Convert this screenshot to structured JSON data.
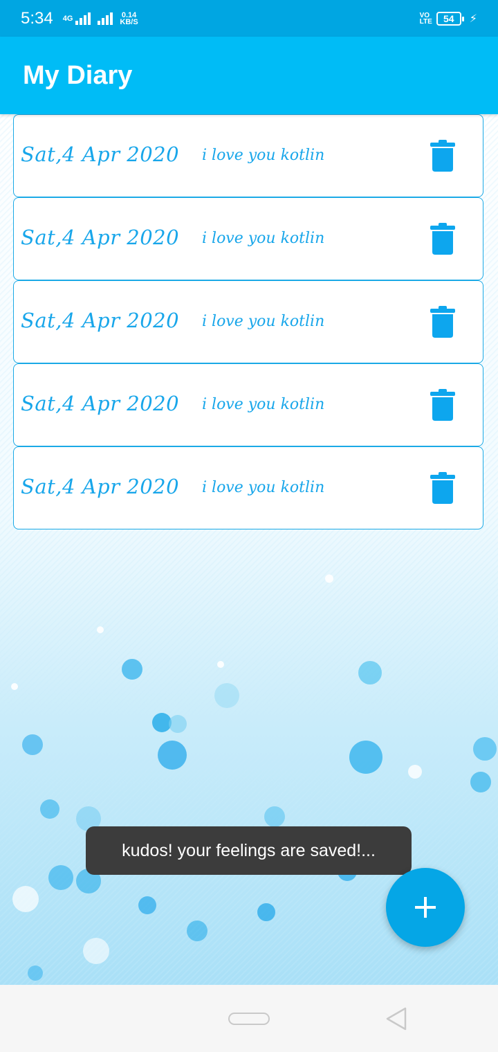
{
  "status_bar": {
    "time": "5:34",
    "network_type": "4G",
    "speed_value": "0.14",
    "speed_unit": "KB/S",
    "volte_top": "VO",
    "volte_bottom": "LTE",
    "battery": "54"
  },
  "app_bar": {
    "title": "My Diary"
  },
  "entries": [
    {
      "date": "Sat,4 Apr 2020",
      "text": "i love you kotlin"
    },
    {
      "date": "Sat,4 Apr 2020",
      "text": "i love you kotlin"
    },
    {
      "date": "Sat,4 Apr 2020",
      "text": "i love you kotlin"
    },
    {
      "date": "Sat,4 Apr 2020",
      "text": "i love you kotlin"
    },
    {
      "date": "Sat,4 Apr 2020",
      "text": "i love you kotlin"
    }
  ],
  "icons": {
    "delete": "trash-icon",
    "add": "plus-icon",
    "home": "home-pill-icon",
    "back": "back-triangle-icon"
  },
  "toast": {
    "message": "kudos! your feelings are saved!..."
  },
  "colors": {
    "status_bar": "#00a6e2",
    "app_bar": "#00bcf6",
    "accent": "#18a6ea",
    "fab": "#05a6e6",
    "toast_bg": "#3c3c3c"
  }
}
